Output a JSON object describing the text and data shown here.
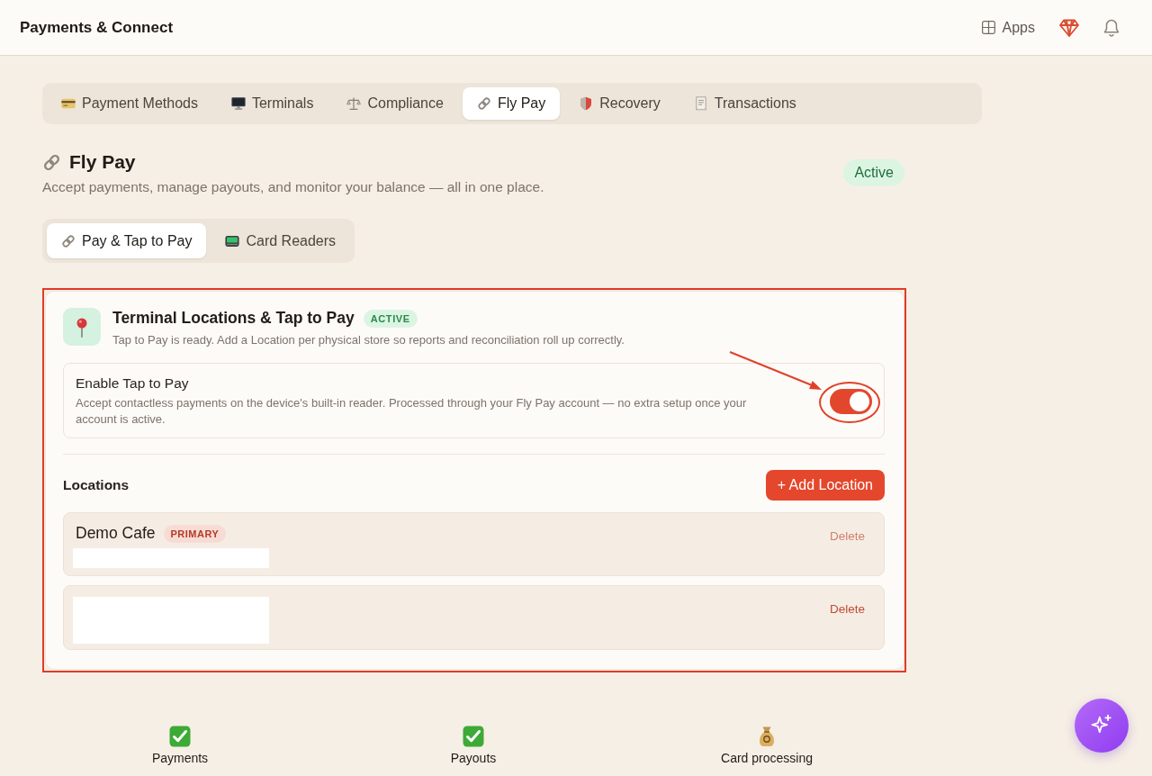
{
  "header": {
    "title": "Payments & Connect",
    "apps_label": "Apps"
  },
  "tabs": [
    {
      "label": "Payment Methods",
      "selected": false
    },
    {
      "label": "Terminals",
      "selected": false
    },
    {
      "label": "Compliance",
      "selected": false
    },
    {
      "label": "Fly Pay",
      "selected": true
    },
    {
      "label": "Recovery",
      "selected": false
    },
    {
      "label": "Transactions",
      "selected": false
    }
  ],
  "section": {
    "title": "Fly Pay",
    "subtitle": "Accept payments, manage payouts, and monitor your balance — all in one place.",
    "status": "Active"
  },
  "subtabs": [
    {
      "label": "Pay & Tap to Pay",
      "selected": true
    },
    {
      "label": "Card Readers",
      "selected": false
    }
  ],
  "card": {
    "title": "Terminal Locations & Tap to Pay",
    "badge": "ACTIVE",
    "description": "Tap to Pay is ready. Add a Location per physical store so reports and reconciliation roll up correctly.",
    "setting": {
      "label": "Enable Tap to Pay",
      "description": "Accept contactless payments on the device's built-in reader. Processed through your Fly Pay account — no extra setup once your account is active.",
      "on": true
    },
    "locations_heading": "Locations",
    "add_button": "+ Add Location",
    "locations": [
      {
        "name": "Demo Cafe",
        "badge": "PRIMARY",
        "redacted": true,
        "delete_label": "Delete",
        "delete_disabled": true
      },
      {
        "redacted": true,
        "delete_label": "Delete",
        "delete_disabled": false
      }
    ]
  },
  "summary": [
    {
      "label": "Payments",
      "kind": "status",
      "complete": true
    },
    {
      "label": "Payouts",
      "kind": "status",
      "complete": true
    },
    {
      "label": "Card processing",
      "kind": "info"
    }
  ],
  "annotations": {
    "card_frame": true,
    "toggle_arrow": true,
    "toggle_circle": true
  }
}
